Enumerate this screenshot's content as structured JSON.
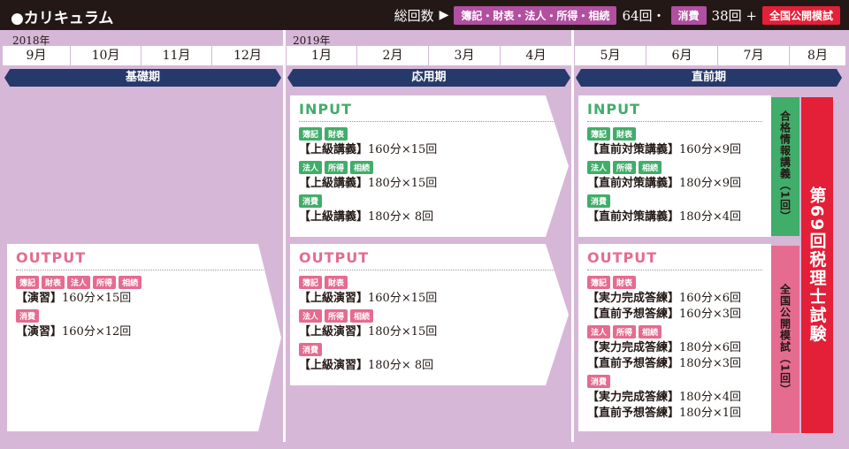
{
  "header": {
    "title": "●カリキュラム",
    "total_label": "総回数",
    "arrow": "▶",
    "subjects_tag": "簿記・財表・法人・所得・相続",
    "subjects_count": "64回・",
    "consumption_tag": "消費",
    "consumption_count": "38回 +",
    "mock_tag": "全国公開模試"
  },
  "timeline": {
    "years": [
      "2018年",
      "2019年"
    ],
    "months": [
      "9月",
      "10月",
      "11月",
      "12月",
      "1月",
      "2月",
      "3月",
      "4月",
      "5月",
      "6月",
      "7月",
      "8月"
    ]
  },
  "phases": [
    "基礎期",
    "応用期",
    "直前期"
  ],
  "basic": {
    "output": {
      "title": "OUTPUT",
      "groups": [
        {
          "tags": [
            "簿記",
            "財表",
            "法人",
            "所得",
            "相続"
          ],
          "lines": [
            {
              "label": "【演習】",
              "detail": "160分×15回"
            }
          ]
        },
        {
          "tags": [
            "消費"
          ],
          "lines": [
            {
              "label": "【演習】",
              "detail": "160分×12回"
            }
          ]
        }
      ]
    }
  },
  "applied": {
    "input": {
      "title": "INPUT",
      "groups": [
        {
          "tags": [
            "簿記",
            "財表"
          ],
          "lines": [
            {
              "label": "【上級講義】",
              "detail": "160分×15回"
            }
          ]
        },
        {
          "tags": [
            "法人",
            "所得",
            "相続"
          ],
          "lines": [
            {
              "label": "【上級講義】",
              "detail": "180分×15回"
            }
          ]
        },
        {
          "tags": [
            "消費"
          ],
          "lines": [
            {
              "label": "【上級講義】",
              "detail": "180分× 8回"
            }
          ]
        }
      ]
    },
    "output": {
      "title": "OUTPUT",
      "groups": [
        {
          "tags": [
            "簿記",
            "財表"
          ],
          "lines": [
            {
              "label": "【上級演習】",
              "detail": "160分×15回"
            }
          ]
        },
        {
          "tags": [
            "法人",
            "所得",
            "相続"
          ],
          "lines": [
            {
              "label": "【上級演習】",
              "detail": "180分×15回"
            }
          ]
        },
        {
          "tags": [
            "消費"
          ],
          "lines": [
            {
              "label": "【上級演習】",
              "detail": "180分× 8回"
            }
          ]
        }
      ]
    }
  },
  "final": {
    "input": {
      "title": "INPUT",
      "groups": [
        {
          "tags": [
            "簿記",
            "財表"
          ],
          "lines": [
            {
              "label": "【直前対策講義】",
              "detail": "160分×9回"
            }
          ]
        },
        {
          "tags": [
            "法人",
            "所得",
            "相続"
          ],
          "lines": [
            {
              "label": "【直前対策講義】",
              "detail": "180分×9回"
            }
          ]
        },
        {
          "tags": [
            "消費"
          ],
          "lines": [
            {
              "label": "【直前対策講義】",
              "detail": "180分×4回"
            }
          ]
        }
      ]
    },
    "output": {
      "title": "OUTPUT",
      "groups": [
        {
          "tags": [
            "簿記",
            "財表"
          ],
          "lines": [
            {
              "label": "【実力完成答練】",
              "detail": "160分×6回"
            },
            {
              "label": "【直前予想答練】",
              "detail": "160分×3回"
            }
          ]
        },
        {
          "tags": [
            "法人",
            "所得",
            "相続"
          ],
          "lines": [
            {
              "label": "【実力完成答練】",
              "detail": "180分×6回"
            },
            {
              "label": "【直前予想答練】",
              "detail": "180分×3回"
            }
          ]
        },
        {
          "tags": [
            "消費"
          ],
          "lines": [
            {
              "label": "【実力完成答練】",
              "detail": "180分×4回"
            },
            {
              "label": "【直前予想答練】",
              "detail": "180分×1回"
            }
          ]
        }
      ]
    },
    "side_input": "合格情報講義（1回）",
    "side_output": "全国公開模試（1回）",
    "exam": "第69回税理士試験"
  },
  "colors": {
    "input": "#41ad6a",
    "output": "#e56b90",
    "navy": "#253a6a",
    "bg": "#d7b7d8",
    "red": "#e41f38"
  }
}
